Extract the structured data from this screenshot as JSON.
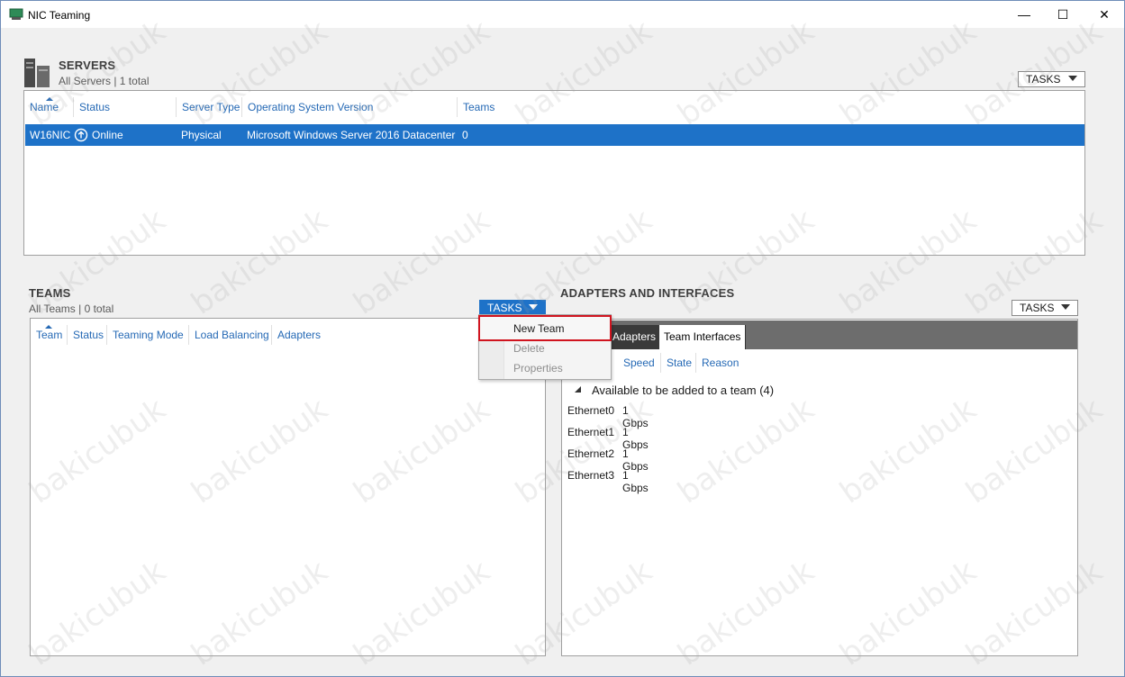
{
  "window": {
    "title": "NIC Teaming",
    "controls": {
      "minimize": "—",
      "maximize": "☐",
      "close": "✕"
    }
  },
  "servers": {
    "title": "SERVERS",
    "subtitle": "All Servers | 1 total",
    "tasks_label": "TASKS",
    "columns": [
      "Name",
      "Status",
      "Server Type",
      "Operating System Version",
      "Teams"
    ],
    "rows": [
      {
        "name": "W16NIC",
        "status": "Online",
        "server_type": "Physical",
        "os": "Microsoft Windows Server 2016 Datacenter",
        "teams": "0"
      }
    ]
  },
  "teams": {
    "title": "TEAMS",
    "subtitle": "All Teams | 0 total",
    "tasks_label": "TASKS",
    "columns": [
      "Team",
      "Status",
      "Teaming Mode",
      "Load Balancing",
      "Adapters"
    ]
  },
  "tasks_menu": {
    "items": [
      {
        "label": "New Team",
        "enabled": true
      },
      {
        "label": "Delete",
        "enabled": false
      },
      {
        "label": "Properties",
        "enabled": false
      }
    ]
  },
  "adapters": {
    "title": "ADAPTERS AND INTERFACES",
    "tasks_label": "TASKS",
    "tabs": [
      "Adapters",
      "Team Interfaces"
    ],
    "columns": [
      "Speed",
      "State",
      "Reason"
    ],
    "group_label": "Available to be added to a team (4)",
    "rows": [
      {
        "name": "Ethernet0",
        "speed": "1 Gbps"
      },
      {
        "name": "Ethernet1",
        "speed": "1 Gbps"
      },
      {
        "name": "Ethernet2",
        "speed": "1 Gbps"
      },
      {
        "name": "Ethernet3",
        "speed": "1 Gbps"
      }
    ]
  },
  "watermark": "bakicubuk",
  "colors": {
    "accent": "#1e72c8",
    "highlight_border": "#d0141f",
    "link_text": "#2569b5"
  }
}
